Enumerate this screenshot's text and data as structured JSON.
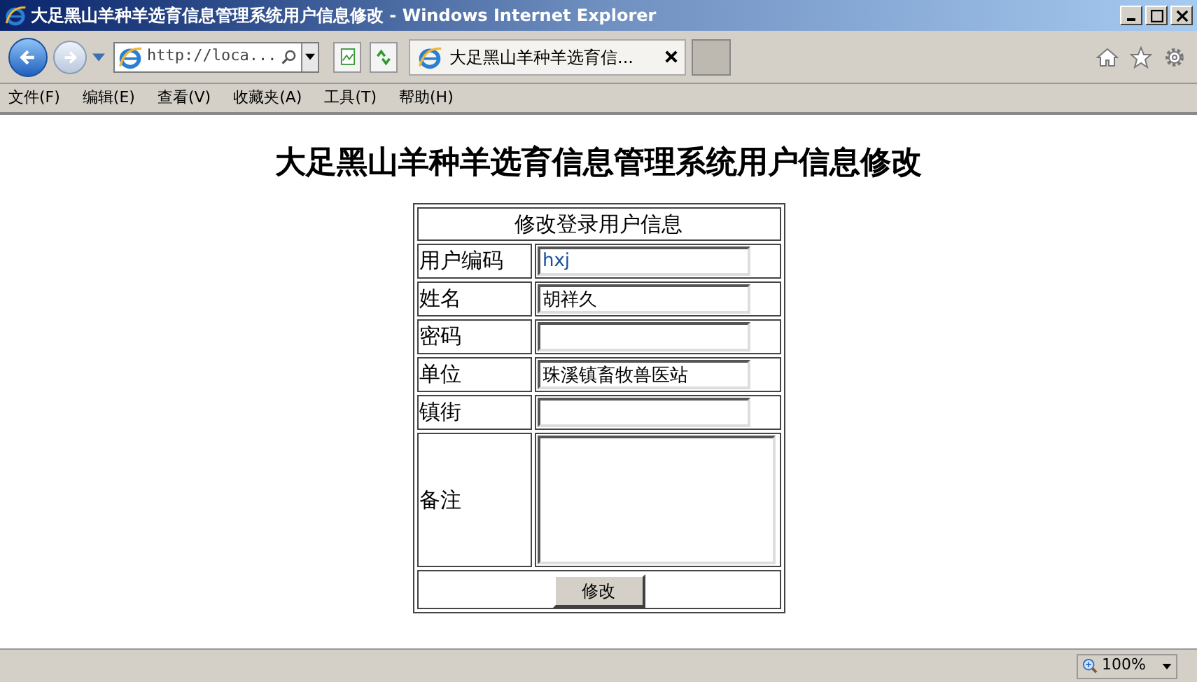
{
  "window": {
    "title": "大足黑山羊种羊选育信息管理系统用户信息修改 - Windows Internet Explorer"
  },
  "address_bar": {
    "value": "http://loca..."
  },
  "tabs": [
    {
      "label": "大足黑山羊种羊选育信...",
      "selected": true
    }
  ],
  "menu": [
    "文件(F)",
    "编辑(E)",
    "查看(V)",
    "收藏夹(A)",
    "工具(T)",
    "帮助(H)"
  ],
  "page": {
    "heading": "大足黑山羊种羊选育信息管理系统用户信息修改",
    "form": {
      "caption": "修改登录用户信息",
      "fields": [
        {
          "label": "用户编码",
          "value": "hxj",
          "kind": "text"
        },
        {
          "label": "姓名",
          "value": "胡祥久",
          "kind": "text"
        },
        {
          "label": "密码",
          "kind": "password"
        },
        {
          "label": "单位",
          "value": "珠溪镇畜牧兽医站",
          "kind": "text"
        },
        {
          "label": "镇街",
          "kind": "text"
        },
        {
          "label": "备注",
          "kind": "textarea"
        }
      ],
      "button": "修改"
    }
  },
  "status_bar": {
    "zoom": "100%"
  }
}
